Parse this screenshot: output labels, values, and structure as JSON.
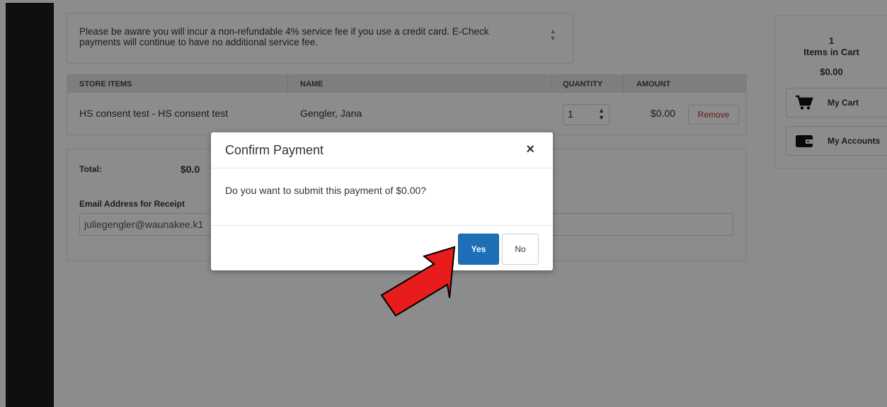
{
  "notice": {
    "text": "Please be aware you will incur a non-refundable 4% service fee if you use a credit card. E-Check payments will continue to have no additional service fee."
  },
  "cart_table": {
    "headers": [
      "STORE ITEMS",
      "NAME",
      "QUANTITY",
      "AMOUNT"
    ],
    "rows": [
      {
        "item": "HS consent test - HS consent test",
        "name": "Gengler, Jana",
        "quantity": "1",
        "amount": "$0.00",
        "remove_label": "Remove"
      }
    ]
  },
  "summary": {
    "total_label": "Total:",
    "total_amount": "$0.0",
    "email_label": "Email Address for Receipt",
    "email_value": "juliegengler@waunakee.k1"
  },
  "right_panel": {
    "count": "1",
    "items_label": "Items in Cart",
    "total": "$0.00",
    "my_cart_label": "My Cart",
    "my_accounts_label": "My Accounts"
  },
  "modal": {
    "title": "Confirm Payment",
    "close_glyph": "×",
    "message": "Do you want to submit this payment of $0.00?",
    "yes_label": "Yes",
    "no_label": "No"
  },
  "colors": {
    "primary": "#1f6fb8",
    "remove_text": "#b03030",
    "arrow": "#e81c1c",
    "sidebar": "#1d1d1d"
  },
  "icons": {
    "cart": "shopping-cart-icon",
    "wallet": "wallet-icon",
    "close": "close-icon",
    "spinner": "spinner-arrows-icon"
  }
}
